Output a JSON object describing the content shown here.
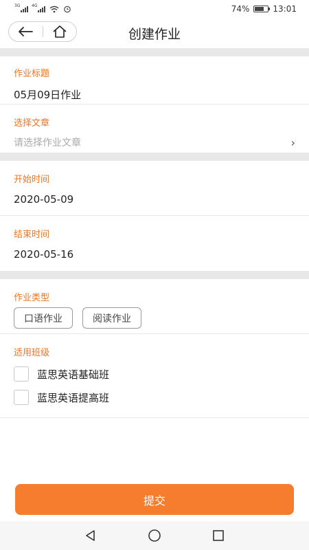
{
  "status_bar": {
    "signal1_tag": "3G",
    "signal2_tag": "4G",
    "battery_percent": "74%",
    "battery_level": 0.74,
    "time": "13:01",
    "icons": [
      "signal-icon",
      "signal-icon",
      "wifi-icon",
      "alarm-icon",
      "battery-icon"
    ]
  },
  "header": {
    "title": "创建作业",
    "back_icon": "back-arrow-icon",
    "home_icon": "home-icon"
  },
  "form": {
    "title_field": {
      "label": "作业标题",
      "value": "05月09日作业"
    },
    "article_field": {
      "label": "选择文章",
      "placeholder": "请选择作业文章",
      "arrow": "›"
    },
    "start_field": {
      "label": "开始时间",
      "value": "2020-05-09"
    },
    "end_field": {
      "label": "结束时间",
      "value": "2020-05-16"
    },
    "type_field": {
      "label": "作业类型",
      "options": [
        "口语作业",
        "阅读作业"
      ]
    },
    "class_field": {
      "label": "适用班级",
      "classes": [
        "蓝思英语基础班",
        "蓝思英语提高班"
      ]
    }
  },
  "submit_label": "提交",
  "colors": {
    "accent": "#ee7524",
    "button": "#f77d2e",
    "divider": "#e8e8e8"
  }
}
